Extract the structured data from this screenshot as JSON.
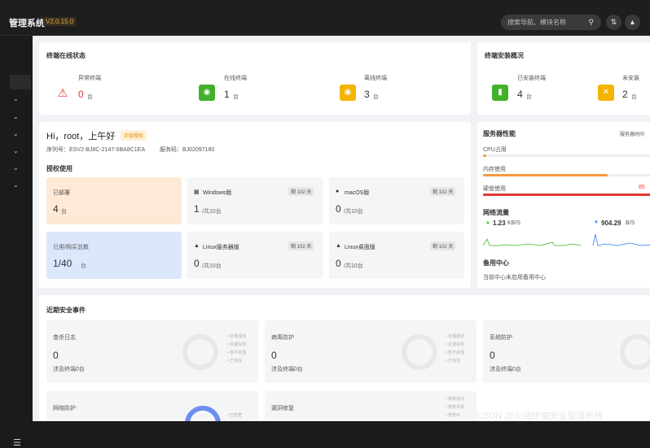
{
  "app": {
    "title": "管理系统",
    "version": "V2.0.15.0"
  },
  "search": {
    "placeholder": "搜索导航、模块名称"
  },
  "terminal_status": {
    "title": "终端在线状态",
    "items": [
      {
        "label": "异常终端",
        "value": "0",
        "unit": "台",
        "color": "#e53935"
      },
      {
        "label": "在线终端",
        "value": "1",
        "unit": "台",
        "color": "#43b02a"
      },
      {
        "label": "离线终端",
        "value": "3",
        "unit": "台",
        "color": "#f4b400"
      }
    ]
  },
  "install": {
    "title": "终端安装概况",
    "items": [
      {
        "label": "已安装终端",
        "value": "4",
        "unit": "台",
        "color": "#43b02a"
      },
      {
        "label": "未安装",
        "value": "2",
        "unit": "台",
        "color": "#f4b400"
      }
    ]
  },
  "greeting": {
    "text": "Hi，root，上午好",
    "badge": "正版授权",
    "serial_label": "序列号：ESV2-BJ8C-2147-5BA8C1EA",
    "service_label": "服务码：BJ02097180"
  },
  "license": {
    "title": "授权使用",
    "deployed": {
      "label": "已部署",
      "value": "4",
      "unit": "台"
    },
    "used": {
      "label": "已用/购买总数",
      "value": "1/40",
      "unit": "台"
    },
    "platforms": [
      {
        "name": "Windows版",
        "badge": "剩 102 天",
        "value": "1",
        "total": "/共10台"
      },
      {
        "name": "macOS版",
        "badge": "剩 102 天",
        "value": "0",
        "total": "/共10台"
      },
      {
        "name": "Linux服务器版",
        "badge": "剩 102 天",
        "value": "0",
        "total": "/共10台"
      },
      {
        "name": "Linux桌面版",
        "badge": "剩 102 天",
        "value": "0",
        "total": "/共10台"
      }
    ]
  },
  "server": {
    "title": "服务器性能",
    "time_label": "服务器时间",
    "cpu": {
      "label": "CPU占用",
      "percent": 2
    },
    "mem": {
      "label": "内存使用",
      "percent": 73
    },
    "disk": {
      "label": "硬盘使用",
      "percent": 98,
      "value_label": "85"
    },
    "network": {
      "title": "网络流量",
      "up": "1.23",
      "up_unit": "KB/S",
      "down": "904.29",
      "down_unit": "B/S"
    },
    "backup": {
      "title": "备用中心",
      "status": "当前中心未启用备用中心"
    }
  },
  "events": {
    "title": "近期安全事件",
    "cards": [
      {
        "title": "查杀日志",
        "value": "0",
        "sub": "涉及终端0台",
        "legend": [
          "处理成功",
          "处理失败",
          "暂不处理",
          "已信任"
        ]
      },
      {
        "title": "病毒防护",
        "value": "0",
        "sub": "涉及终端0台",
        "legend": [
          "处理成功",
          "处理失败",
          "暂不处理",
          "已信任"
        ]
      },
      {
        "title": "系统防护",
        "value": "0",
        "sub": "涉及终端0台"
      },
      {
        "title": "网络防护",
        "legend": [
          "已检查"
        ]
      },
      {
        "title": "漏洞修复",
        "legend": [
          "修复成功",
          "修复失败",
          "修复中"
        ]
      }
    ]
  },
  "watermark": "CSDN @火绒终端安全管理系统"
}
